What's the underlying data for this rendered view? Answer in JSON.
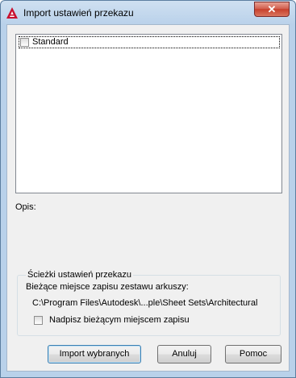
{
  "window": {
    "title": "Import ustawień przekazu",
    "close_label": "✕"
  },
  "list": {
    "items": [
      {
        "label": "Standard",
        "checked": false
      }
    ]
  },
  "description": {
    "label": "Opis:"
  },
  "paths_group": {
    "legend": "Ścieżki ustawień przekazu",
    "location_label": "Bieżące miejsce zapisu zestawu arkuszy:",
    "location_path": "C:\\Program Files\\Autodesk\\...ple\\Sheet Sets\\Architectural",
    "overwrite_label": "Nadpisz bieżącym miejscem zapisu",
    "overwrite_checked": false
  },
  "buttons": {
    "import": "Import wybranych",
    "cancel": "Anuluj",
    "help": "Pomoc"
  },
  "colors": {
    "accent": "#3c7fb1",
    "titlebar": "#b9d1ea",
    "close": "#c7402c"
  },
  "icons": {
    "app": "autocad-logo-icon",
    "close": "close-icon"
  }
}
